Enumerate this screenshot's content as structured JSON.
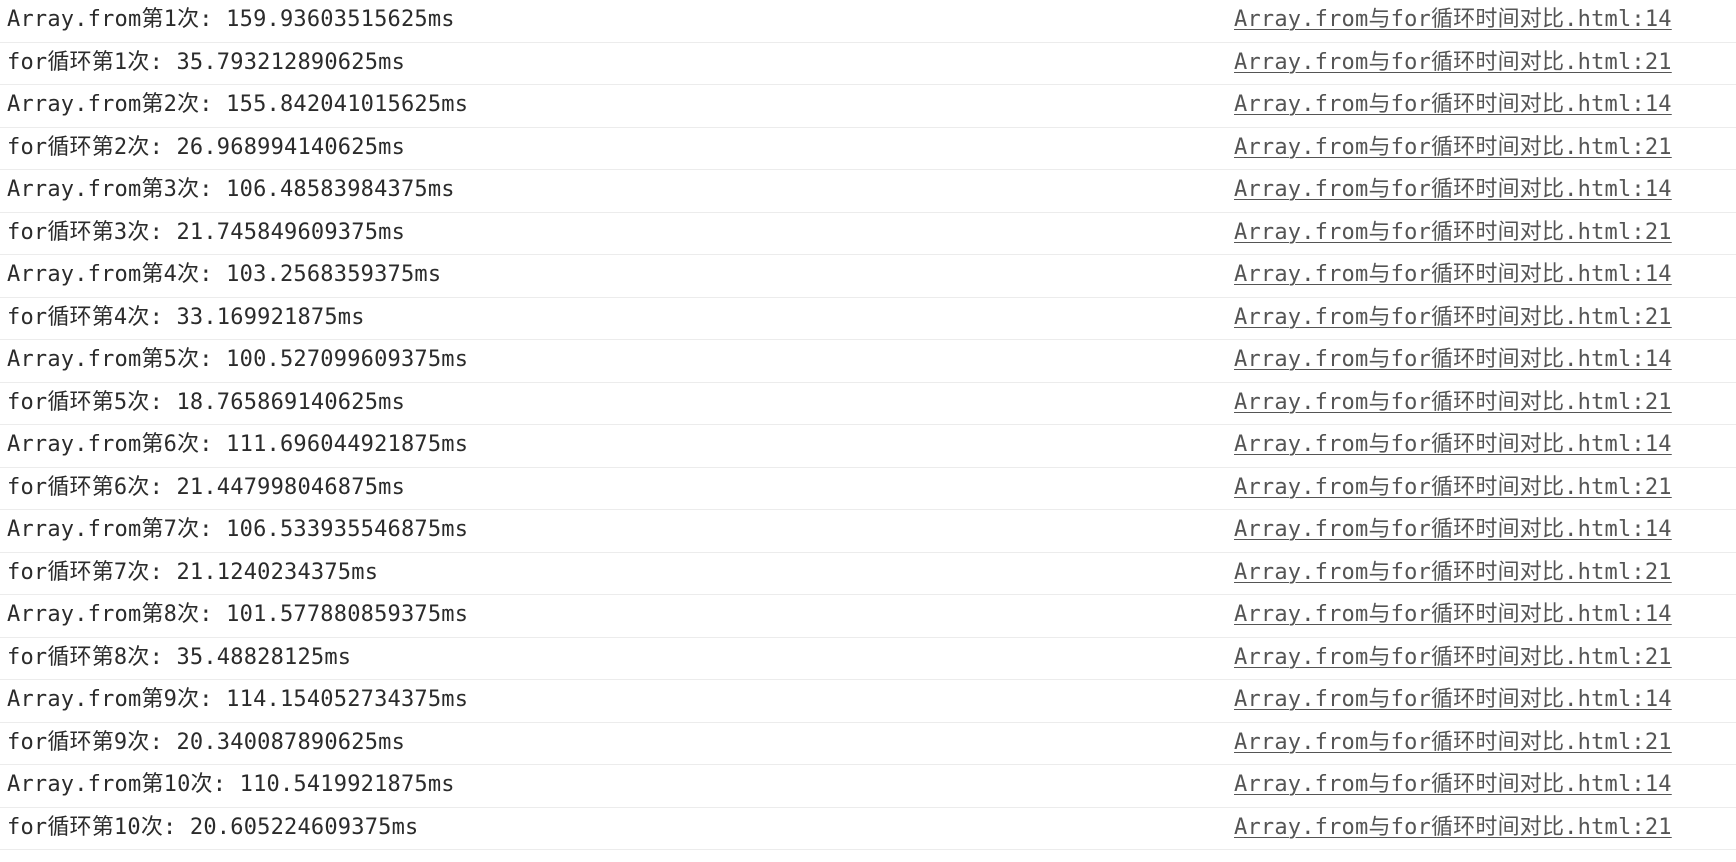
{
  "console": {
    "rows": [
      {
        "message": "Array.from第1次: 159.93603515625ms",
        "source": "Array.from与for循环时间对比.html:14"
      },
      {
        "message": "for循环第1次: 35.793212890625ms",
        "source": "Array.from与for循环时间对比.html:21"
      },
      {
        "message": "Array.from第2次: 155.842041015625ms",
        "source": "Array.from与for循环时间对比.html:14"
      },
      {
        "message": "for循环第2次: 26.968994140625ms",
        "source": "Array.from与for循环时间对比.html:21"
      },
      {
        "message": "Array.from第3次: 106.48583984375ms",
        "source": "Array.from与for循环时间对比.html:14"
      },
      {
        "message": "for循环第3次: 21.745849609375ms",
        "source": "Array.from与for循环时间对比.html:21"
      },
      {
        "message": "Array.from第4次: 103.2568359375ms",
        "source": "Array.from与for循环时间对比.html:14"
      },
      {
        "message": "for循环第4次: 33.169921875ms",
        "source": "Array.from与for循环时间对比.html:21"
      },
      {
        "message": "Array.from第5次: 100.527099609375ms",
        "source": "Array.from与for循环时间对比.html:14"
      },
      {
        "message": "for循环第5次: 18.765869140625ms",
        "source": "Array.from与for循环时间对比.html:21"
      },
      {
        "message": "Array.from第6次: 111.696044921875ms",
        "source": "Array.from与for循环时间对比.html:14"
      },
      {
        "message": "for循环第6次: 21.447998046875ms",
        "source": "Array.from与for循环时间对比.html:21"
      },
      {
        "message": "Array.from第7次: 106.533935546875ms",
        "source": "Array.from与for循环时间对比.html:14"
      },
      {
        "message": "for循环第7次: 21.1240234375ms",
        "source": "Array.from与for循环时间对比.html:21"
      },
      {
        "message": "Array.from第8次: 101.577880859375ms",
        "source": "Array.from与for循环时间对比.html:14"
      },
      {
        "message": "for循环第8次: 35.48828125ms",
        "source": "Array.from与for循环时间对比.html:21"
      },
      {
        "message": "Array.from第9次: 114.154052734375ms",
        "source": "Array.from与for循环时间对比.html:14"
      },
      {
        "message": "for循环第9次: 20.340087890625ms",
        "source": "Array.from与for循环时间对比.html:21"
      },
      {
        "message": "Array.from第10次: 110.5419921875ms",
        "source": "Array.from与for循环时间对比.html:14"
      },
      {
        "message": "for循环第10次: 20.605224609375ms",
        "source": "Array.from与for循环时间对比.html:21"
      }
    ]
  }
}
